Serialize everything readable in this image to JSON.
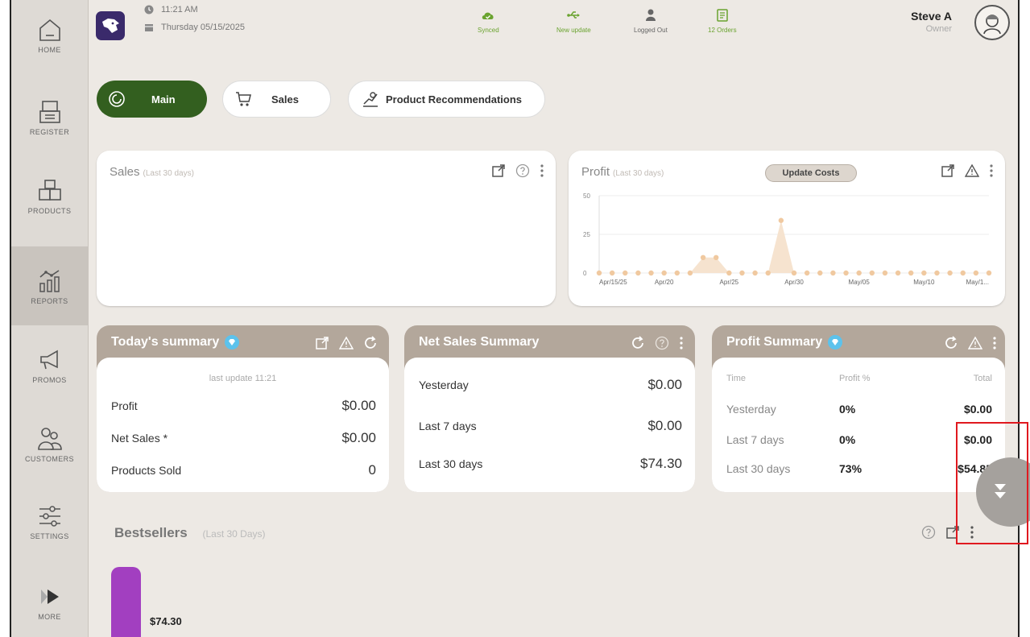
{
  "sidebar": {
    "items": [
      {
        "label": "HOME",
        "icon": "home-icon"
      },
      {
        "label": "REGISTER",
        "icon": "register-icon"
      },
      {
        "label": "PRODUCTS",
        "icon": "products-icon"
      },
      {
        "label": "REPORTS",
        "icon": "reports-icon",
        "active": true
      },
      {
        "label": "PROMOS",
        "icon": "megaphone-icon"
      },
      {
        "label": "CUSTOMERS",
        "icon": "customers-icon"
      },
      {
        "label": "SETTINGS",
        "icon": "sliders-icon"
      },
      {
        "label": "MORE",
        "icon": "play-icon"
      }
    ]
  },
  "topbar": {
    "time": "11:21 AM",
    "date": "Thursday 05/15/2025",
    "status": [
      {
        "label": "Synced",
        "icon": "cloud-check-icon",
        "color": "#6aa32f"
      },
      {
        "label": "New update",
        "icon": "usb-icon",
        "color": "#6aa32f"
      },
      {
        "label": "Logged Out",
        "icon": "user-icon",
        "color": "#666666"
      },
      {
        "label": "12 Orders",
        "icon": "orders-icon",
        "color": "#6aa32f"
      }
    ],
    "user": {
      "name": "Steve A",
      "role": "Owner"
    }
  },
  "tabs": [
    {
      "label": "Main",
      "icon": "gauge-icon",
      "active": true
    },
    {
      "label": "Sales",
      "icon": "cart-icon"
    },
    {
      "label": "Product Recommendations",
      "icon": "recommend-icon"
    }
  ],
  "sales_card": {
    "title": "Sales",
    "subtitle": "(Last 30 days)"
  },
  "profit_card": {
    "title": "Profit",
    "subtitle": "(Last 30 days)",
    "button": "Update Costs",
    "chart_data": {
      "type": "area",
      "x": [
        "Apr/15/25",
        "Apr/16",
        "Apr/17",
        "Apr/18",
        "Apr/19",
        "Apr/20",
        "Apr/21",
        "Apr/22",
        "Apr/23",
        "Apr/24",
        "Apr/25",
        "Apr/26",
        "Apr/27",
        "Apr/28",
        "Apr/29",
        "Apr/30",
        "May/01",
        "May/02",
        "May/03",
        "May/04",
        "May/05",
        "May/06",
        "May/07",
        "May/08",
        "May/09",
        "May/10",
        "May/11",
        "May/12",
        "May/13",
        "May/14",
        "May/15"
      ],
      "values": [
        0,
        0,
        0,
        0,
        0,
        0,
        0,
        0,
        10,
        10,
        0,
        0,
        0,
        0,
        34,
        0,
        0,
        0,
        0,
        0,
        0,
        0,
        0,
        0,
        0,
        0,
        0,
        0,
        0,
        0,
        0
      ],
      "xticks": [
        "Apr/15/25",
        "Apr/20",
        "Apr/25",
        "Apr/30",
        "May/05",
        "May/10",
        "May/1..."
      ],
      "xtick_index": [
        0,
        5,
        10,
        15,
        20,
        25,
        30
      ],
      "yticks": [
        "50",
        "25",
        "0"
      ],
      "ylim": [
        0,
        50
      ],
      "color": "#f0c9a0"
    }
  },
  "today_summary": {
    "title": "Today's summary",
    "last_update": "last update 11:21",
    "rows": [
      {
        "label": "Profit",
        "value": "$0.00"
      },
      {
        "label": "Net Sales *",
        "value": "$0.00"
      },
      {
        "label": "Products Sold",
        "value": "0"
      }
    ]
  },
  "net_sales": {
    "title": "Net Sales Summary",
    "rows": [
      {
        "label": "Yesterday",
        "value": "$0.00"
      },
      {
        "label": "Last 7 days",
        "value": "$0.00"
      },
      {
        "label": "Last 30 days",
        "value": "$74.30"
      }
    ]
  },
  "profit_summary": {
    "title": "Profit Summary",
    "headers": {
      "time": "Time",
      "pct": "Profit %",
      "total": "Total"
    },
    "rows": [
      {
        "label": "Yesterday",
        "pct": "0%",
        "total": "$0.00"
      },
      {
        "label": "Last 7 days",
        "pct": "0%",
        "total": "$0.00"
      },
      {
        "label": "Last 30 days",
        "pct": "73%",
        "total": "$54.85"
      }
    ]
  },
  "bestsellers": {
    "title": "Bestsellers",
    "subtitle": "(Last 30 Days)",
    "value": "$74.30",
    "bar_color": "#a23fc0"
  }
}
